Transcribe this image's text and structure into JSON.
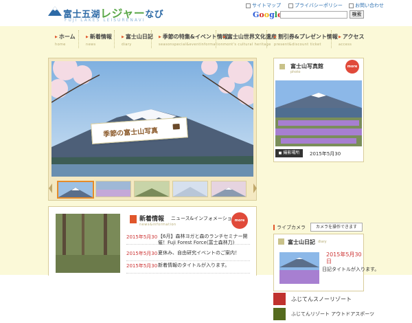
{
  "header": {
    "logo_title_1": "富士五湖",
    "logo_title_2": "レジャー",
    "logo_title_3": "なび",
    "logo_sub": "FUJI LAKES LEISURENAVI",
    "toplinks": [
      {
        "label": "サイトマップ"
      },
      {
        "label": "プライバシーポリシー"
      },
      {
        "label": "お問い合わせ"
      }
    ],
    "search": {
      "brand": "Google",
      "placeholder": "",
      "button_label": "検索"
    }
  },
  "nav": [
    {
      "jp": "ホーム",
      "en": "home"
    },
    {
      "jp": "新着情報",
      "en": "news"
    },
    {
      "jp": "富士山日記",
      "en": "diary"
    },
    {
      "jp": "季節の特集&イベント情報",
      "en": "seasonspecial&eventinformation"
    },
    {
      "jp": "富士山世界文化遺産",
      "en": "mont's cultural heritage"
    },
    {
      "jp": "割引券&プレゼント情報",
      "en": "present&discount ticket"
    },
    {
      "jp": "アクセス",
      "en": "access"
    }
  ],
  "hero": {
    "label": "季節の富士山写真",
    "thumb_count": 5
  },
  "news": {
    "title": "新着情報",
    "subtitle": "ニュース&インフォメーション",
    "en": "news&information",
    "more": "more",
    "items": [
      {
        "date": "2015年5月30",
        "text": "【6月】森林ヨガと森のランチセミナー開催！Fuji Forest Force(富士森林力)"
      },
      {
        "date": "2015年5月30",
        "text": "夏休み、自由研究イベントのご案内！"
      },
      {
        "date": "2015年5月30",
        "text": "新着情報のタイトルが入ります。"
      }
    ]
  },
  "sidebar": {
    "photo": {
      "title": "富士山写真館",
      "en": "photo",
      "more": "more",
      "loc_label": "撮影場所",
      "date": "2015年5月30"
    },
    "live": {
      "label": "ライブカメラ",
      "button": "カメラを操作できます"
    },
    "diary": {
      "title": "富士山日記",
      "en": "diary",
      "date": "2015年5月30",
      "date2": "日",
      "text": "日記タイトルが入ります。"
    },
    "links": [
      {
        "label": "ふじてんスノーリゾート"
      },
      {
        "label": "ふじてんリゾート アウトドアスポーツ"
      }
    ]
  },
  "colors": {
    "accent": "#e0562b",
    "band": "#fbf9d8",
    "link": "#2b6fb0"
  }
}
